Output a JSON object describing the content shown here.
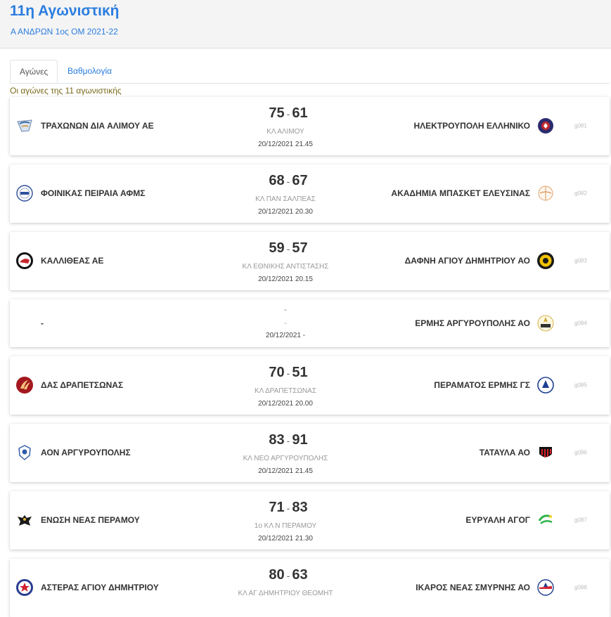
{
  "header": {
    "title": "11η Αγωνιστική",
    "subtitle": "Α ΑΝΔΡΩΝ 1ος ΟΜ 2021-22"
  },
  "tabs": [
    {
      "label": "Αγώνες",
      "active": true
    },
    {
      "label": "Βαθμολογία",
      "active": false
    }
  ],
  "info_text": "Οι αγώνες της 11 αγωνιστικής",
  "games": [
    {
      "home": "ΤΡΑΧΩΝΩΝ ΔΙΑ ΑΛΙΜΟΥ ΑΕ",
      "home_logo": "alimos-logo",
      "home_score": "75",
      "away_score": "61",
      "venue": "ΚΛ ΑΛΙΜΟΥ",
      "datetime": "20/12/2021 21.45",
      "away": "ΗΛΕΚΤΡΟΥΠΟΛΗ ΕΛΛΗΝΙΚΟ",
      "away_logo": "ilektroupoli-logo",
      "code": "g081"
    },
    {
      "home": "ΦΟΙΝΙΚΑΣ ΠΕΙΡΑΙΑ ΑΦΜΣ",
      "home_logo": "foinikas-logo",
      "home_score": "68",
      "away_score": "67",
      "venue": "ΚΛ ΠΑΝ ΣΑΛΠΕΑΣ",
      "datetime": "20/12/2021 20.30",
      "away": "ΑΚΑΔΗΜΙΑ ΜΠΑΣΚΕΤ ΕΛΕΥΣΙΝΑΣ",
      "away_logo": "elefsina-logo",
      "code": "g082"
    },
    {
      "home": "ΚΑΛΛΙΘΕΑΣ ΑΕ",
      "home_logo": "kallithea-logo",
      "home_score": "59",
      "away_score": "57",
      "venue": "ΚΛ ΕΘΝΙΚΗΣ ΑΝΤΙΣΤΑΣΗΣ",
      "datetime": "20/12/2021 20.15",
      "away": "ΔΑΦΝΗ ΑΓΙΟΥ ΔΗΜΗΤΡΙΟΥ ΑΟ",
      "away_logo": "dafni-logo",
      "code": "g083"
    },
    {
      "home": "-",
      "home_logo": "",
      "home_score": "",
      "away_score": "",
      "score_text": "-",
      "venue": "-",
      "datetime": "20/12/2021 -",
      "away": "ΕΡΜΗΣ ΑΡΓΥΡΟΥΠΟΛΗΣ ΑΟ",
      "away_logo": "ermis-logo",
      "code": "g084"
    },
    {
      "home": "ΔΑΣ ΔΡΑΠΕΤΣΩΝΑΣ",
      "home_logo": "drapetsona-logo",
      "home_score": "70",
      "away_score": "51",
      "venue": "ΚΛ ΔΡΑΠΕΤΣΩΝΑΣ",
      "datetime": "20/12/2021 20.00",
      "away": "ΠΕΡΑΜΑΤΟΣ ΕΡΜΗΣ ΓΣ",
      "away_logo": "perama-logo",
      "code": "g085"
    },
    {
      "home": "ΑΟΝ ΑΡΓΥΡΟΥΠΟΛΗΣ",
      "home_logo": "aon-logo",
      "home_score": "83",
      "away_score": "91",
      "venue": "ΚΛ ΝΕΟ ΑΡΓΥΡΟΥΠΟΛΗΣ",
      "datetime": "20/12/2021 21.45",
      "away": "ΤΑΤΑΥΛΑ ΑΟ",
      "away_logo": "tatavla-logo",
      "code": "g086"
    },
    {
      "home": "ΕΝΩΣΗ ΝΕΑΣ ΠΕΡΑΜΟΥ",
      "home_logo": "neperamos-logo",
      "home_score": "71",
      "away_score": "83",
      "venue": "1ο ΚΛ Ν ΠΕΡΑΜΟΥ",
      "datetime": "20/12/2021 21.30",
      "away": "ΕΥΡΥΑΛΗ ΑΓΟΓ",
      "away_logo": "evryali-logo",
      "code": "g087"
    },
    {
      "home": "ΑΣΤΕΡΑΣ ΑΓΙΟΥ ΔΗΜΗΤΡΙΟΥ",
      "home_logo": "asteras-logo",
      "home_score": "80",
      "away_score": "63",
      "venue": "ΚΛ ΑΓ ΔΗΜΗΤΡΙΟΥ ΘΕΟΜΗΤ",
      "datetime": "",
      "away": "ΙΚΑΡΟΣ ΝΕΑΣ ΣΜΥΡΝΗΣ ΑΟ",
      "away_logo": "ikaros-logo",
      "code": "g088"
    }
  ]
}
